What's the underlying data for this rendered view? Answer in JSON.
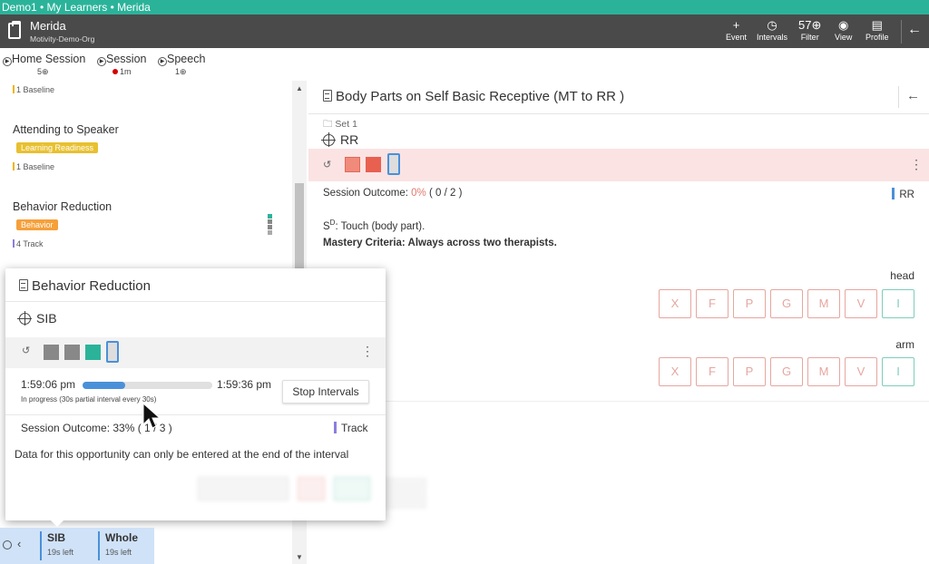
{
  "window": {
    "title": "Demo1 • My Learners • Merida"
  },
  "header": {
    "learner": "Merida",
    "org": "Motivity-Demo-Org",
    "event_label": "Event",
    "intervals_label": "Intervals",
    "filter_count": "57",
    "filter_label": "Filter",
    "view_label": "View",
    "profile_label": "Profile"
  },
  "session_tabs": [
    {
      "label": "Home Session",
      "sub": "5"
    },
    {
      "label": "Session",
      "sub": "1m"
    },
    {
      "label": "Speech",
      "sub": "1"
    }
  ],
  "left_list": {
    "top_tag": "1 Baseline",
    "goals": [
      {
        "title": "Attending to Speaker",
        "chip": "Learning Readiness",
        "tag": "1 Baseline"
      },
      {
        "title": "Behavior Reduction",
        "chip": "Behavior",
        "tag": "4 Track"
      }
    ]
  },
  "right_panel": {
    "title": "Body Parts on Self Basic Receptive (MT to RR )",
    "set": "Set 1",
    "target": "RR",
    "outcome_label": "Session Outcome: ",
    "outcome_pct": "0%",
    "outcome_frac": " ( 0 / 2 )",
    "phase": "RR",
    "sd_prefix": "S",
    "sd_sup": "D",
    "sd_text": ": Touch (body part).",
    "mastery": "Mastery Criteria: Always across two therapists.",
    "trials": [
      {
        "label": "head",
        "prompts": [
          "X",
          "F",
          "P",
          "G",
          "M",
          "V",
          "I"
        ]
      },
      {
        "label": "arm",
        "prompts": [
          "X",
          "F",
          "P",
          "G",
          "M",
          "V",
          "I"
        ]
      }
    ]
  },
  "popup": {
    "title": "Behavior Reduction",
    "target": "SIB",
    "start_time": "1:59:06 pm",
    "end_time": "1:59:36 pm",
    "progress": 0.33,
    "progress_text": "In progress (30s partial interval every 30s)",
    "stop_label": "Stop Intervals",
    "outcome": "Session Outcome: 33% ( 1 / 3 )",
    "phase": "Track",
    "note": "Data for this opportunity can only be entered at the end of the interval"
  },
  "bottom_tabs": [
    {
      "name": "SIB",
      "time": "19s left"
    },
    {
      "name": "Whole",
      "time": "19s left"
    }
  ],
  "colors": {
    "teal": "#2bb39a",
    "header": "#4a4a4a",
    "baseline": "#f0b400",
    "learning_readiness": "#e8c030",
    "behavior": "#f5a03a",
    "track": "#8a7ee0",
    "incorrect": "#e07a6e",
    "correct": "#7ecdbb"
  }
}
